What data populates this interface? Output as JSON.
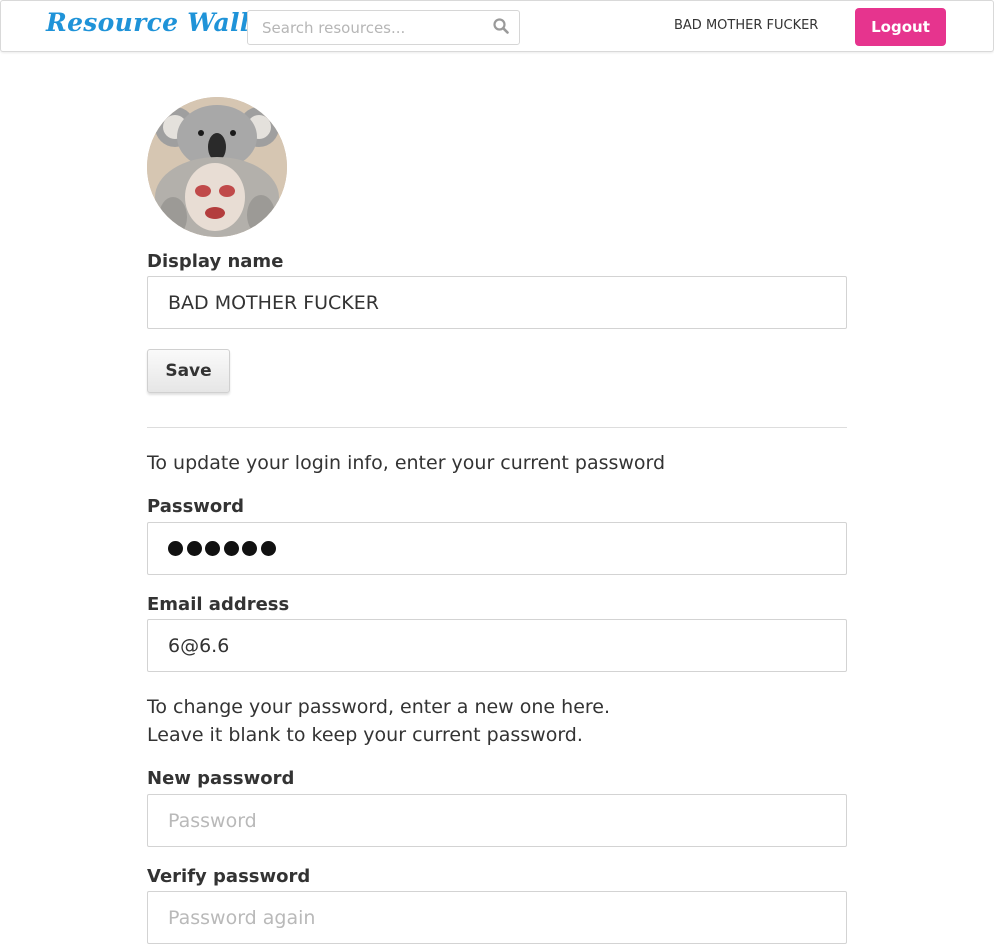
{
  "navbar": {
    "brand": "Resource Wall",
    "search_placeholder": "Search resources...",
    "search_icon": "search-icon",
    "user_name": "BAD MOTHER FUCKER",
    "logout_label": "Logout",
    "brand_color": "#1f93d8",
    "logout_color": "#e6348e"
  },
  "profile": {
    "avatar_icon": "user-avatar-photo",
    "display_name_label": "Display name",
    "display_name_value": "BAD MOTHER FUCKER",
    "save_label": "Save"
  },
  "login_info": {
    "intro": "To update your login info, enter your current password",
    "password_label": "Password",
    "password_masked_length": 6,
    "email_label": "Email address",
    "email_value": "6@6.6",
    "change_password_line1": "To change your password, enter a new one here.",
    "change_password_line2": "Leave it blank to keep your current password.",
    "new_password_label": "New password",
    "new_password_placeholder": "Password",
    "verify_password_label": "Verify password",
    "verify_password_placeholder": "Password again"
  }
}
